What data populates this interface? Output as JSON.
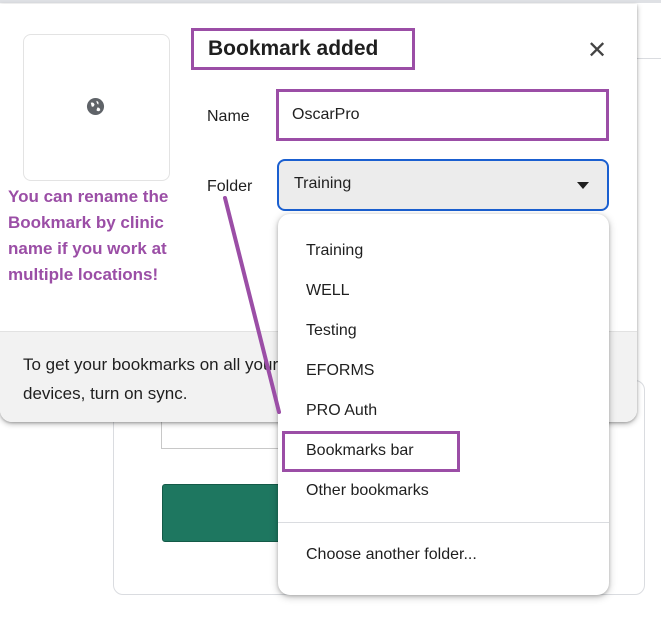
{
  "dialog": {
    "title": "Bookmark added",
    "close_icon": "close-icon",
    "thumbnail_icon": "globe-icon",
    "name_label": "Name",
    "name_value": "OscarPro",
    "folder_label": "Folder",
    "folder_value": "Training",
    "sync_message": "To get your bookmarks on all your devices, turn on sync."
  },
  "annotation": {
    "text": "You can rename the Bookmark by clinic name if you work at multiple locations!",
    "color": "#9b4ea6"
  },
  "folder_menu": {
    "items": [
      "Training",
      "WELL",
      "Testing",
      "EFORMS",
      "PRO Auth",
      "Bookmarks bar",
      "Other bookmarks"
    ],
    "choose_other": "Choose another folder..."
  },
  "colors": {
    "accent": "#1a5fd0",
    "annotation": "#9b4ea6",
    "page_button": "#1e7760"
  }
}
